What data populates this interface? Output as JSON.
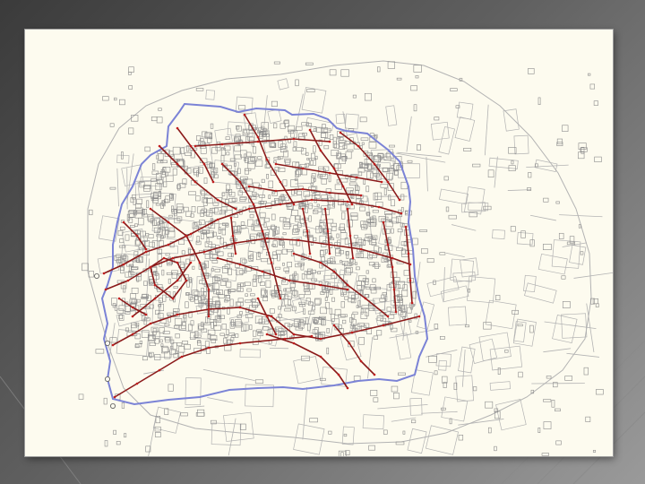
{
  "colors": {
    "slide_background_dark": "#3b3b3b",
    "slide_background_light": "#9a9a9a",
    "map_background": "#fdfbef",
    "building_outline": "#8c8c8c",
    "parcel_line": "#b3b3b3",
    "boundary_line": "#7b83d6",
    "network_line": "#8b1a1a",
    "network_node": "#c21e1e"
  },
  "layers": [
    "parcels",
    "buildings",
    "boundary",
    "network",
    "nodes"
  ]
}
